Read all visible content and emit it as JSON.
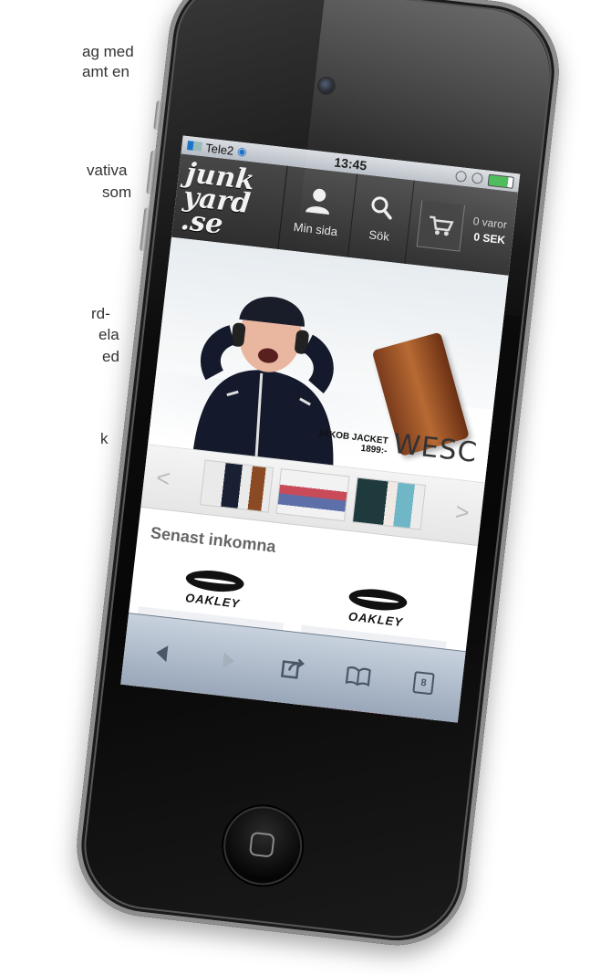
{
  "background_text": [
    "ag med",
    "amt en",
    "vativa",
    "som",
    "rd-",
    "ela",
    "ed",
    "k"
  ],
  "status_bar": {
    "carrier": "Tele2",
    "time": "13:45"
  },
  "site_header": {
    "logo_lines": [
      "junk",
      "yard",
      ".se"
    ],
    "my_page_label": "Min sida",
    "search_label": "Sök",
    "cart_items": "0 varor",
    "cart_total": "0 SEK"
  },
  "hero": {
    "caption_product": "JAKOB JACKET",
    "caption_price": "1899:-",
    "brand": "WESC"
  },
  "carousel": {
    "prev_label": "<",
    "next_label": ">",
    "thumbnails": [
      "thumb-jacket",
      "thumb-sneakers",
      "thumb-lifestyle"
    ]
  },
  "section": {
    "title": "Senast inkomna"
  },
  "products": [
    {
      "brand": "OAKLEY",
      "color": "#3b140c"
    },
    {
      "brand": "OAKLEY",
      "color": "#d8202c"
    }
  ],
  "toolbar": {
    "back_icon": "back-arrow-icon",
    "forward_icon": "forward-arrow-icon",
    "share_icon": "share-icon",
    "bookmarks_icon": "bookmarks-icon",
    "pages_icon": "pages-icon",
    "pages_count": "8"
  },
  "colors": {
    "header_bg": "#2e2e2e",
    "toolbar_bg": "#99a7b9",
    "wifi_blue": "#1a73c9"
  }
}
